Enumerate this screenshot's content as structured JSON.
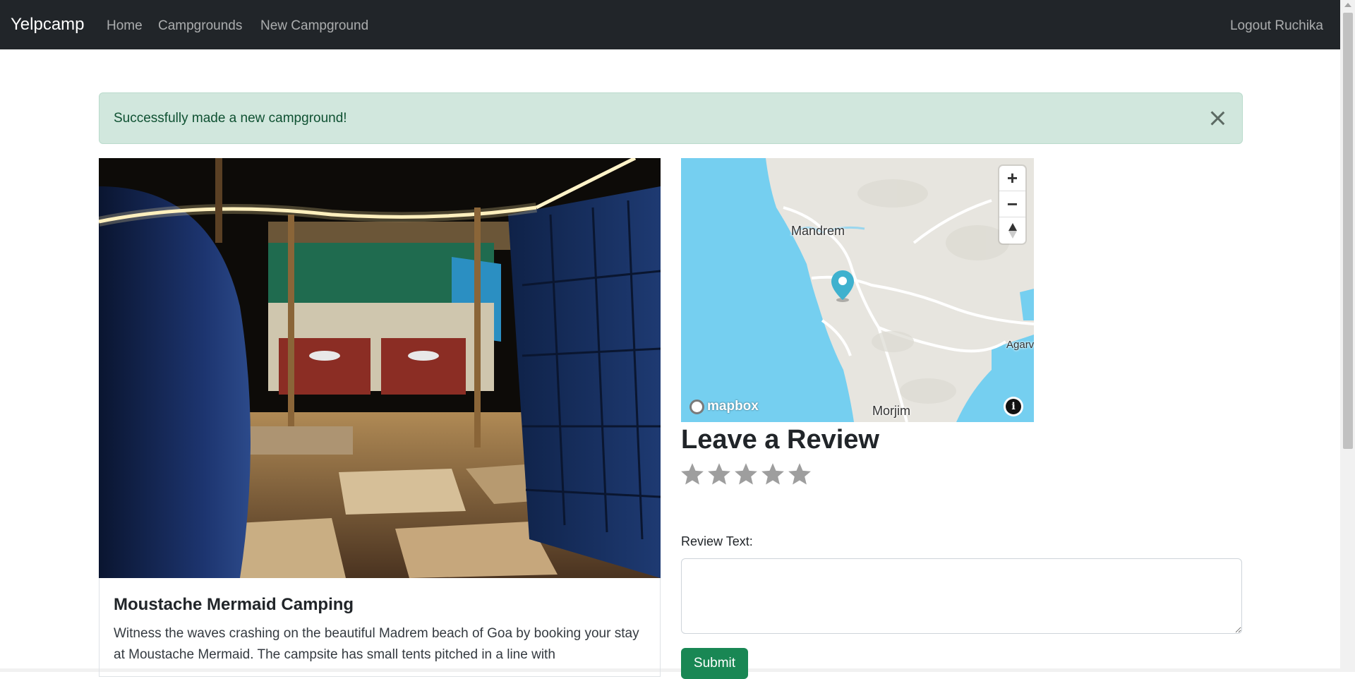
{
  "navbar": {
    "brand": "Yelpcamp",
    "links": [
      "Home",
      "Campgrounds",
      "New Campground"
    ],
    "logout": "Logout Ruchika"
  },
  "alert": {
    "message": "Successfully made a new campground!"
  },
  "campground": {
    "title": "Moustache Mermaid Camping",
    "description": "Witness the waves crashing on the beautiful Madrem beach of Goa by booking your stay at Moustache Mermaid. The campsite has small tents pitched in a line with"
  },
  "map": {
    "labels": {
      "mandrem": "Mandrem",
      "morjim": "Morjim",
      "agarv": "Agarv"
    },
    "attribution": "mapbox",
    "controls": {
      "zoom_in": "+",
      "zoom_out": "−",
      "compass": "▲",
      "info": "i"
    }
  },
  "review": {
    "heading": "Leave a Review",
    "rating_max": 5,
    "text_label": "Review Text:",
    "text_value": "",
    "submit_label": "Submit"
  },
  "colors": {
    "navbar_bg": "#212529",
    "alert_bg": "#d1e7dd",
    "alert_text": "#0f5132",
    "submit_bg": "#198754",
    "water": "#75cff0",
    "land": "#e7e5df",
    "marker": "#3fb1ce",
    "star": "#9e9e9e"
  }
}
